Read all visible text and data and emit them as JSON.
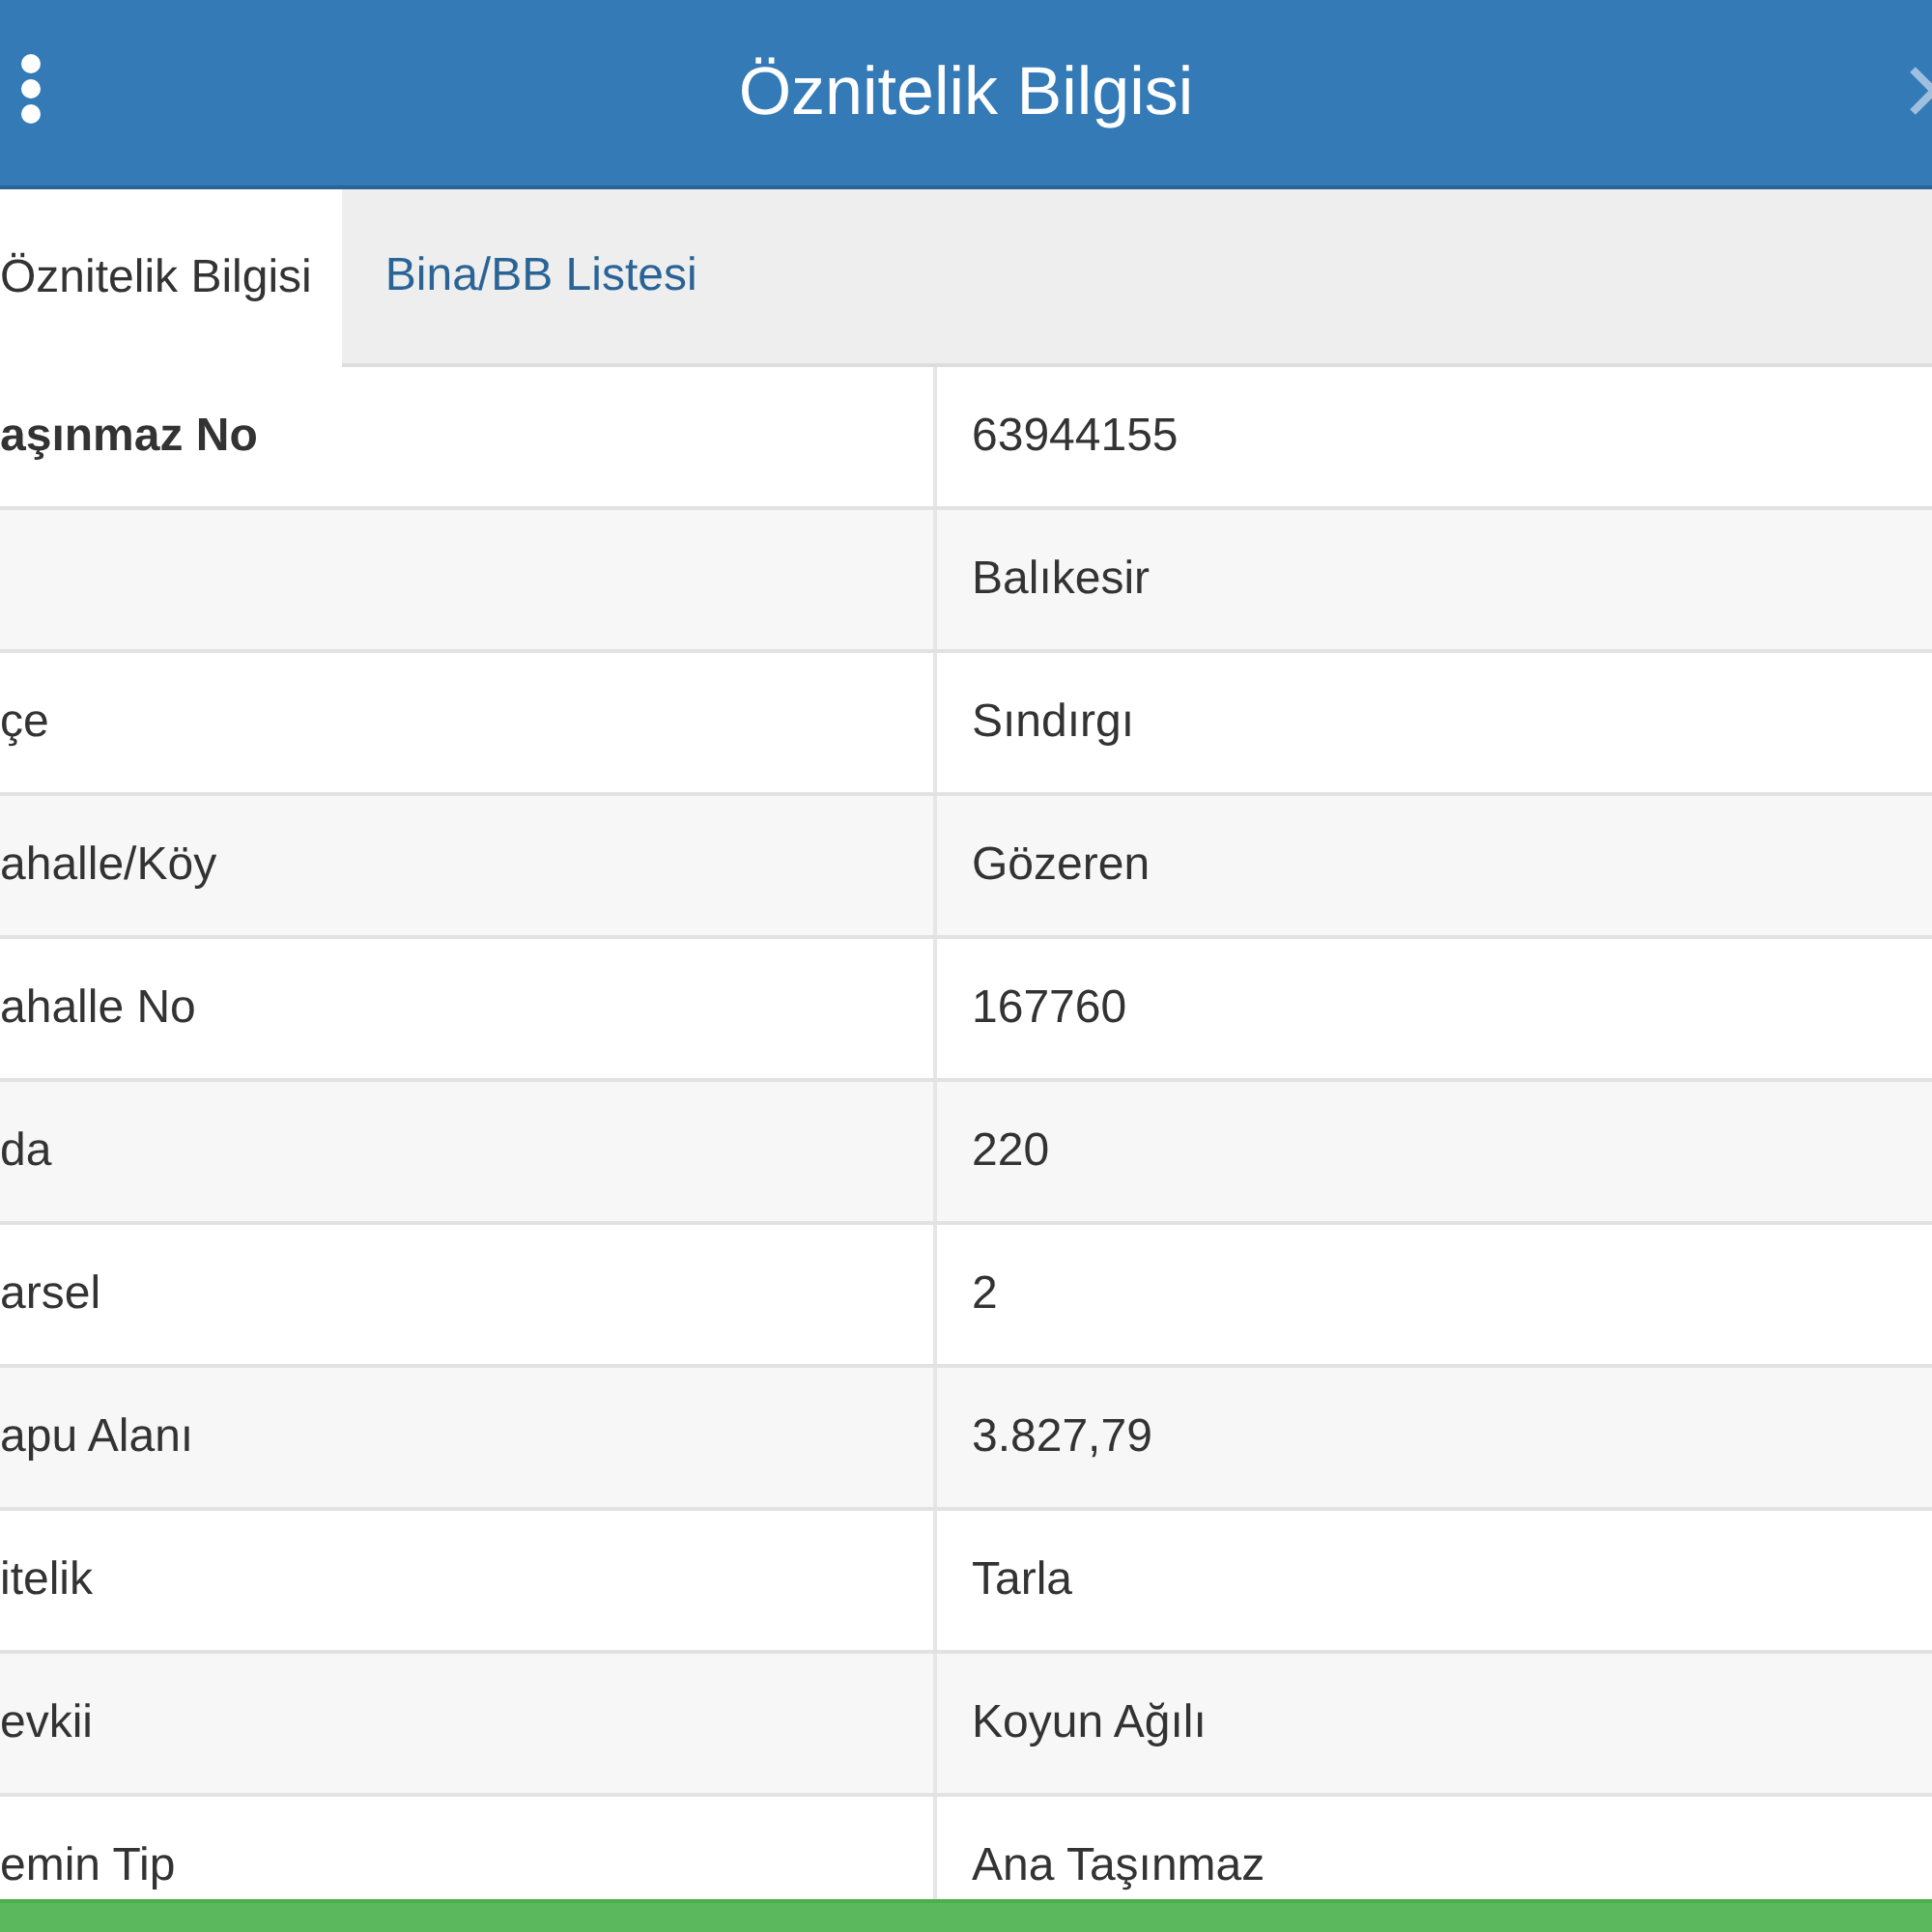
{
  "header": {
    "title": "Öznitelik Bilgisi"
  },
  "tabs": [
    {
      "label": "Öznitelik Bilgisi",
      "selected": true
    },
    {
      "label": "Bina/BB Listesi",
      "selected": false
    }
  ],
  "rows": [
    {
      "label": "aşınmaz No",
      "value": "63944155",
      "bold": true
    },
    {
      "value": "Balıkesir",
      "bold": false
    },
    {
      "label": "çe",
      "value": "Sındırgı",
      "bold": false
    },
    {
      "label": "ahalle/Köy",
      "value": "Gözeren",
      "bold": false
    },
    {
      "label": "ahalle No",
      "value": "167760",
      "bold": false
    },
    {
      "label": "da",
      "value": "220",
      "bold": false
    },
    {
      "label": "arsel",
      "value": "2",
      "bold": false
    },
    {
      "label": "apu Alanı",
      "value": "3.827,79",
      "bold": false
    },
    {
      "label": "itelik",
      "value": "Tarla",
      "bold": false
    },
    {
      "label": "evkii",
      "value": "Koyun Ağılı",
      "bold": false
    },
    {
      "label": "emin Tip",
      "value": "Ana Taşınmaz",
      "bold": false
    }
  ]
}
